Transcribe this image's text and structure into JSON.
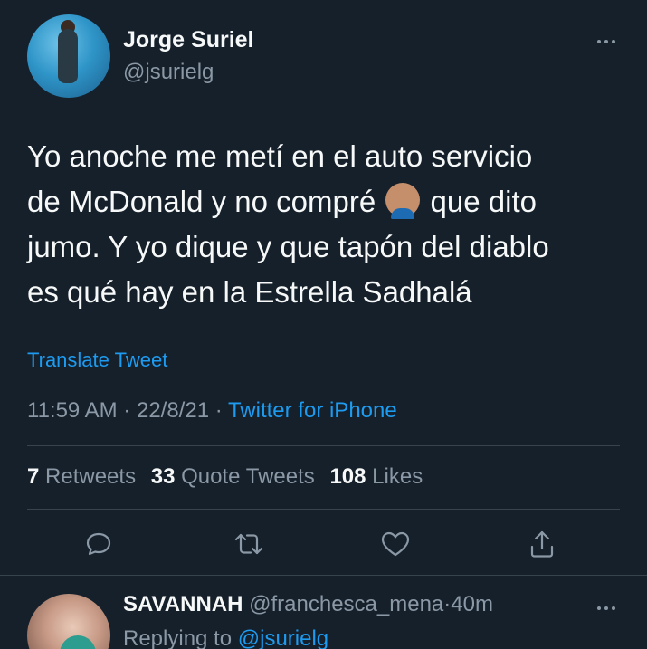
{
  "tweet": {
    "author": {
      "display_name": "Jorge Suriel",
      "handle": "@jsurielg"
    },
    "text_line1": "Yo anoche me metí en el auto servicio",
    "text_line2a": "de McDonald y no compré ",
    "emoji": "facepalm-emoji",
    "text_line2b": " que dito",
    "text_line3": "jumo. Y yo dique y que tapón del diablo",
    "text_line4": "es qué hay en la Estrella Sadhalá",
    "translate_label": "Translate Tweet",
    "time": "11:59 AM",
    "date": "22/8/21",
    "separator": "·",
    "source": "Twitter for iPhone"
  },
  "stats": {
    "retweets_count": "7",
    "retweets_label": "Retweets",
    "quote_count": "33",
    "quote_label": "Quote Tweets",
    "likes_count": "108",
    "likes_label": "Likes"
  },
  "actions": [
    "reply-icon",
    "retweet-icon",
    "like-icon",
    "share-icon"
  ],
  "reply": {
    "display_name": "SAVANNAH",
    "handle": "@franchesca_mena",
    "separator": "·",
    "time_ago": "40m",
    "replying_label": "Replying to",
    "replying_handle": "@jsurielg"
  },
  "colors": {
    "background": "#15202b",
    "text": "#f7f9f9",
    "secondary": "#8b98a5",
    "accent": "#1d9bf0",
    "divider": "#38444d"
  }
}
